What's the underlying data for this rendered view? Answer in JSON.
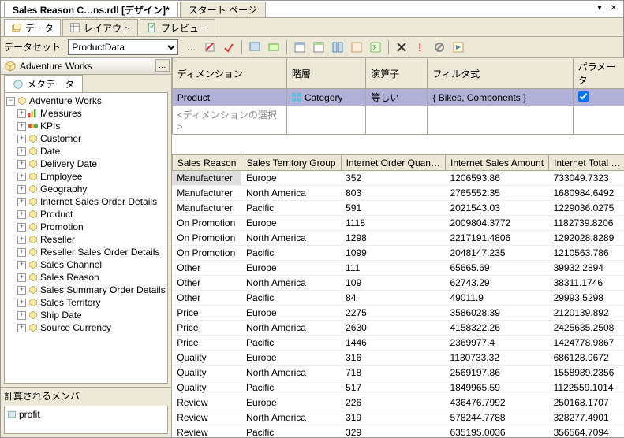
{
  "docTabs": {
    "active": "Sales Reason C…ns.rdl [デザイン]*",
    "other": "スタート ページ"
  },
  "winButtons": {
    "dropdown": "▾",
    "close": "✕"
  },
  "subTabs": {
    "data": "データ",
    "layout": "レイアウト",
    "preview": "プレビュー"
  },
  "datasetBar": {
    "label": "データセット:",
    "value": "ProductData",
    "ellipsis": "…"
  },
  "cubeHeader": {
    "title": "Adventure Works",
    "btn": "…"
  },
  "leftTab": {
    "metadata": "メタデータ"
  },
  "tree": {
    "root": "Adventure Works",
    "nodes": [
      {
        "label": "Measures",
        "icon": "measures"
      },
      {
        "label": "KPIs",
        "icon": "kpi"
      },
      {
        "label": "Customer",
        "icon": "dim"
      },
      {
        "label": "Date",
        "icon": "dim"
      },
      {
        "label": "Delivery Date",
        "icon": "dim"
      },
      {
        "label": "Employee",
        "icon": "dim"
      },
      {
        "label": "Geography",
        "icon": "dim"
      },
      {
        "label": "Internet Sales Order Details",
        "icon": "dim"
      },
      {
        "label": "Product",
        "icon": "dim"
      },
      {
        "label": "Promotion",
        "icon": "dim"
      },
      {
        "label": "Reseller",
        "icon": "dim"
      },
      {
        "label": "Reseller Sales Order Details",
        "icon": "dim"
      },
      {
        "label": "Sales Channel",
        "icon": "dim"
      },
      {
        "label": "Sales Reason",
        "icon": "dim"
      },
      {
        "label": "Sales Summary Order Details",
        "icon": "dim"
      },
      {
        "label": "Sales Territory",
        "icon": "dim"
      },
      {
        "label": "Ship Date",
        "icon": "dim"
      },
      {
        "label": "Source Currency",
        "icon": "dim"
      }
    ]
  },
  "calc": {
    "header": "計算されるメンバ",
    "item": "profit"
  },
  "filterGrid": {
    "headers": {
      "dimension": "ディメンション",
      "hierarchy": "階層",
      "operator": "演算子",
      "filter": "フィルタ式",
      "param": "パラメータ"
    },
    "row": {
      "dimension": "Product",
      "hierarchy": "Category",
      "operator": "等しい",
      "filter": "{ Bikes, Components }",
      "paramChecked": true
    },
    "placeholder": "<ディメンションの選択>"
  },
  "dataGrid": {
    "headers": [
      "Sales Reason",
      "Sales Territory Group",
      "Internet Order Quan…",
      "Internet Sales Amount",
      "Internet Total …"
    ],
    "rows": [
      [
        "Manufacturer",
        "Europe",
        "352",
        "1206593.86",
        "733049.7323"
      ],
      [
        "Manufacturer",
        "North America",
        "803",
        "2765552.35",
        "1680984.6492"
      ],
      [
        "Manufacturer",
        "Pacific",
        "591",
        "2021543.03",
        "1229036.0275"
      ],
      [
        "On Promotion",
        "Europe",
        "1118",
        "2009804.3772",
        "1182739.8206"
      ],
      [
        "On Promotion",
        "North America",
        "1298",
        "2217191.4806",
        "1292028.8289"
      ],
      [
        "On Promotion",
        "Pacific",
        "1099",
        "2048147.235",
        "1210563.786"
      ],
      [
        "Other",
        "Europe",
        "111",
        "65665.69",
        "39932.2894"
      ],
      [
        "Other",
        "North America",
        "109",
        "62743.29",
        "38311.1746"
      ],
      [
        "Other",
        "Pacific",
        "84",
        "49011.9",
        "29993.5298"
      ],
      [
        "Price",
        "Europe",
        "2275",
        "3586028.39",
        "2120139.892"
      ],
      [
        "Price",
        "North America",
        "2630",
        "4158322.26",
        "2425635.2508"
      ],
      [
        "Price",
        "Pacific",
        "1446",
        "2369977.4",
        "1424778.9867"
      ],
      [
        "Quality",
        "Europe",
        "316",
        "1130733.32",
        "686128.9672"
      ],
      [
        "Quality",
        "North America",
        "718",
        "2569197.86",
        "1558989.2356"
      ],
      [
        "Quality",
        "Pacific",
        "517",
        "1849965.59",
        "1122559.1014"
      ],
      [
        "Review",
        "Europe",
        "226",
        "436476.7992",
        "250168.1707"
      ],
      [
        "Review",
        "North America",
        "319",
        "578244.7788",
        "328277.4901"
      ],
      [
        "Review",
        "Pacific",
        "329",
        "635195.0036",
        "356564.7094"
      ]
    ]
  }
}
